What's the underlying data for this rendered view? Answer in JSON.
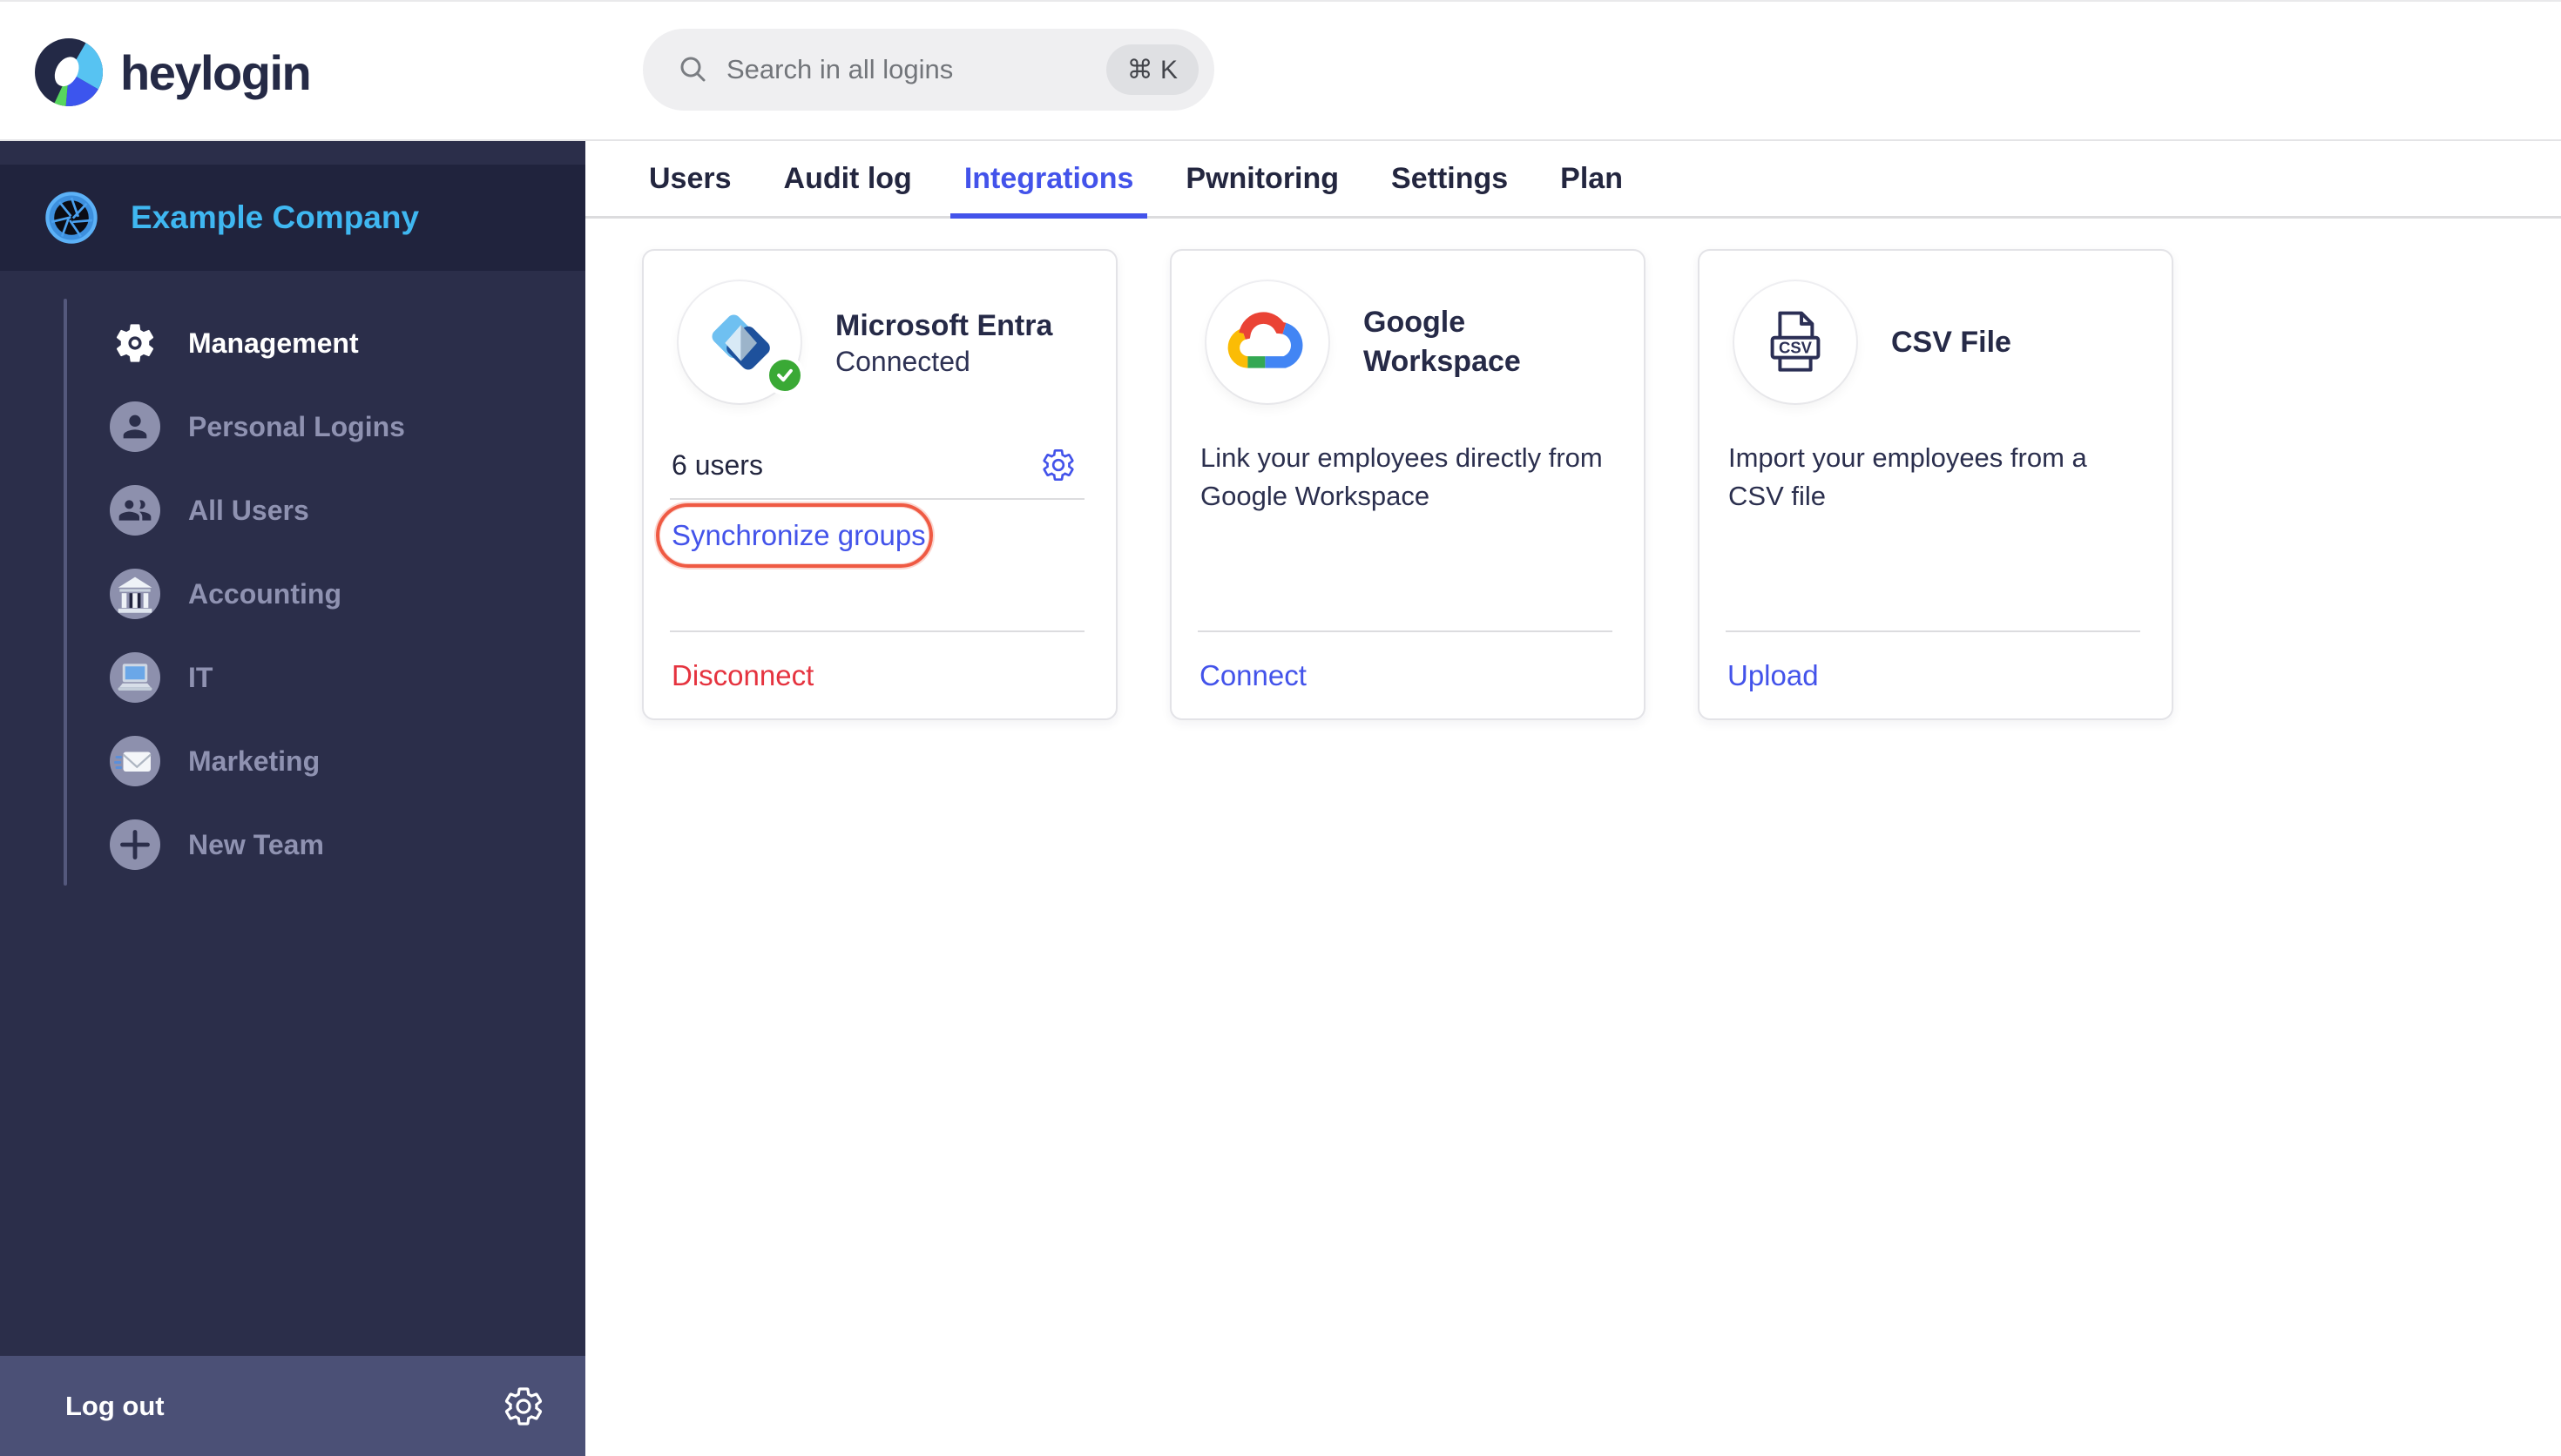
{
  "topbar": {
    "brand": "heylogin",
    "search": {
      "placeholder": "Search in all logins",
      "shortcut": "⌘ K"
    }
  },
  "sidebar": {
    "company": "Example Company",
    "items": [
      {
        "label": "Management",
        "icon": "gear",
        "active": true
      },
      {
        "label": "Personal Logins",
        "icon": "person",
        "active": false
      },
      {
        "label": "All Users",
        "icon": "people",
        "active": false
      },
      {
        "label": "Accounting",
        "icon": "bank",
        "active": false
      },
      {
        "label": "IT",
        "icon": "laptop",
        "active": false
      },
      {
        "label": "Marketing",
        "icon": "envelope",
        "active": false
      },
      {
        "label": "New Team",
        "icon": "plus",
        "active": false
      }
    ],
    "logout": "Log out"
  },
  "tabs": {
    "items": [
      {
        "label": "Users"
      },
      {
        "label": "Audit log"
      },
      {
        "label": "Integrations"
      },
      {
        "label": "Pwnitoring"
      },
      {
        "label": "Settings"
      },
      {
        "label": "Plan"
      }
    ],
    "active": "Integrations"
  },
  "cards": {
    "entra": {
      "title": "Microsoft Entra",
      "status": "Connected",
      "users": "6 users",
      "sync_label": "Synchronize groups",
      "disconnect_label": "Disconnect"
    },
    "google": {
      "title": "Google Workspace",
      "description": "Link your employees directly from Google Workspace",
      "connect_label": "Connect"
    },
    "csv": {
      "title": "CSV File",
      "description": "Import your employees from a CSV file",
      "upload_label": "Upload"
    }
  },
  "colors": {
    "accent": "#4353ea",
    "danger": "#e5333f",
    "highlight_annotation": "#ef5a43",
    "company_name": "#3fb7f1",
    "success_badge": "#3aa935"
  }
}
